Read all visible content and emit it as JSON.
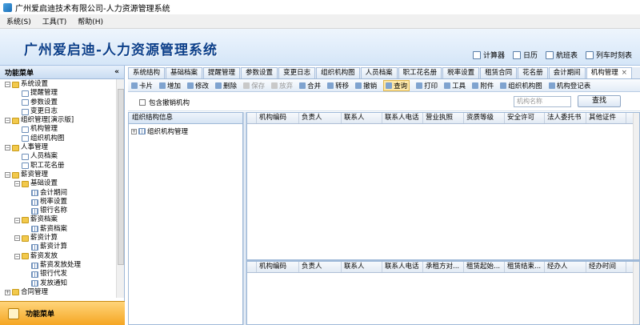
{
  "window": {
    "title": "广州爱启迪技术有限公司-人力资源管理系统"
  },
  "menu": [
    "系统(S)",
    "工具(T)",
    "帮助(H)"
  ],
  "banner": {
    "logo_text": "广州爱启迪-人力资源管理系统",
    "quick_links": [
      {
        "label": "计算器",
        "icon": "calculator-icon"
      },
      {
        "label": "日历",
        "icon": "calendar-icon"
      },
      {
        "label": "航班表",
        "icon": "flight-icon"
      },
      {
        "label": "列车时刻表",
        "icon": "train-icon"
      }
    ]
  },
  "sidebar": {
    "title": "功能菜单",
    "collapse_glyph": "«",
    "footer_label": "功能菜单",
    "tree": [
      {
        "label": "系统设置",
        "level": 0,
        "kind": "folder",
        "expander": "−"
      },
      {
        "label": "提醒管理",
        "level": 1,
        "kind": "doc"
      },
      {
        "label": "参数设置",
        "level": 1,
        "kind": "doc"
      },
      {
        "label": "变更日志",
        "level": 1,
        "kind": "doc"
      },
      {
        "label": "组织管理[演示版]",
        "level": 0,
        "kind": "folder",
        "expander": "−"
      },
      {
        "label": "机构管理",
        "level": 1,
        "kind": "doc"
      },
      {
        "label": "组织机构图",
        "level": 1,
        "kind": "doc"
      },
      {
        "label": "人事管理",
        "level": 0,
        "kind": "folder",
        "expander": "−"
      },
      {
        "label": "人员档案",
        "level": 1,
        "kind": "doc"
      },
      {
        "label": "职工花名册",
        "level": 1,
        "kind": "doc"
      },
      {
        "label": "薪资管理",
        "level": 0,
        "kind": "folder",
        "expander": "−"
      },
      {
        "label": "基础设置",
        "level": 1,
        "kind": "folder",
        "expander": "−"
      },
      {
        "label": "会计期间",
        "level": 2,
        "kind": "grid"
      },
      {
        "label": "税率设置",
        "level": 2,
        "kind": "grid"
      },
      {
        "label": "银行名称",
        "level": 2,
        "kind": "grid"
      },
      {
        "label": "薪资档案",
        "level": 1,
        "kind": "folder",
        "expander": "−"
      },
      {
        "label": "薪资档案",
        "level": 2,
        "kind": "grid"
      },
      {
        "label": "薪资计算",
        "level": 1,
        "kind": "folder",
        "expander": "−"
      },
      {
        "label": "薪资计算",
        "level": 2,
        "kind": "grid"
      },
      {
        "label": "薪资发放",
        "level": 1,
        "kind": "folder",
        "expander": "−"
      },
      {
        "label": "薪资发放处理",
        "level": 2,
        "kind": "grid"
      },
      {
        "label": "银行代发",
        "level": 2,
        "kind": "grid"
      },
      {
        "label": "发放通知",
        "level": 2,
        "kind": "grid"
      },
      {
        "label": "合同管理",
        "level": 0,
        "kind": "folder",
        "expander": "+"
      }
    ]
  },
  "tabs": [
    "系统结构",
    "基础档案",
    "提醒管理",
    "参数设置",
    "变更日志",
    "组织机构图",
    "人员档案",
    "职工花名册",
    "税率设置",
    "租赁合同",
    "花名册",
    "会计期间",
    "机构管理"
  ],
  "active_tab": "机构管理",
  "tab_close_glyph": "×",
  "toolbar": [
    {
      "label": "卡片",
      "icon": "card-icon",
      "enabled": true
    },
    {
      "label": "增加",
      "icon": "add-icon",
      "enabled": true
    },
    {
      "label": "修改",
      "icon": "edit-icon",
      "enabled": true
    },
    {
      "label": "删除",
      "icon": "delete-icon",
      "enabled": true
    },
    {
      "label": "保存",
      "icon": "save-icon",
      "enabled": false
    },
    {
      "label": "放弃",
      "icon": "undo-icon",
      "enabled": false
    },
    {
      "label": "合并",
      "icon": "merge-icon",
      "enabled": true
    },
    {
      "label": "转移",
      "icon": "transfer-icon",
      "enabled": true
    },
    {
      "label": "撤销",
      "icon": "revoke-icon",
      "enabled": true
    },
    {
      "label": "查询",
      "icon": "query-icon",
      "enabled": true,
      "highlighted": true
    },
    {
      "label": "打印",
      "icon": "print-icon",
      "enabled": true
    },
    {
      "label": "工具",
      "icon": "tool-icon",
      "enabled": true
    },
    {
      "label": "附件",
      "icon": "attachment-icon",
      "enabled": true
    },
    {
      "label": "组织机构图",
      "icon": "org-chart-icon",
      "enabled": true
    },
    {
      "label": "机构登记表",
      "icon": "register-icon",
      "enabled": true
    }
  ],
  "search": {
    "include_revoked_label": "包含撤销机构",
    "placeholder": "机构名称",
    "button_label": "查找"
  },
  "org_tree": {
    "header": "组织结构信息",
    "root": "组织机构管理",
    "expander": "+"
  },
  "grid_main": {
    "columns": [
      "机构编码",
      "负责人",
      "联系人",
      "联系人电话",
      "营业执照",
      "资质等级",
      "安全许可",
      "法人委托书",
      "其他证件"
    ],
    "rows": []
  },
  "grid_detail": {
    "columns": [
      "机构编码",
      "负责人",
      "联系人",
      "联系人电话",
      "承租方对...",
      "租赁起始...",
      "租赁结束...",
      "经办人",
      "经办时间"
    ],
    "rows": []
  },
  "colors": {
    "banner_text": "#0b3f8a",
    "footer_accent": "#f5a623"
  }
}
